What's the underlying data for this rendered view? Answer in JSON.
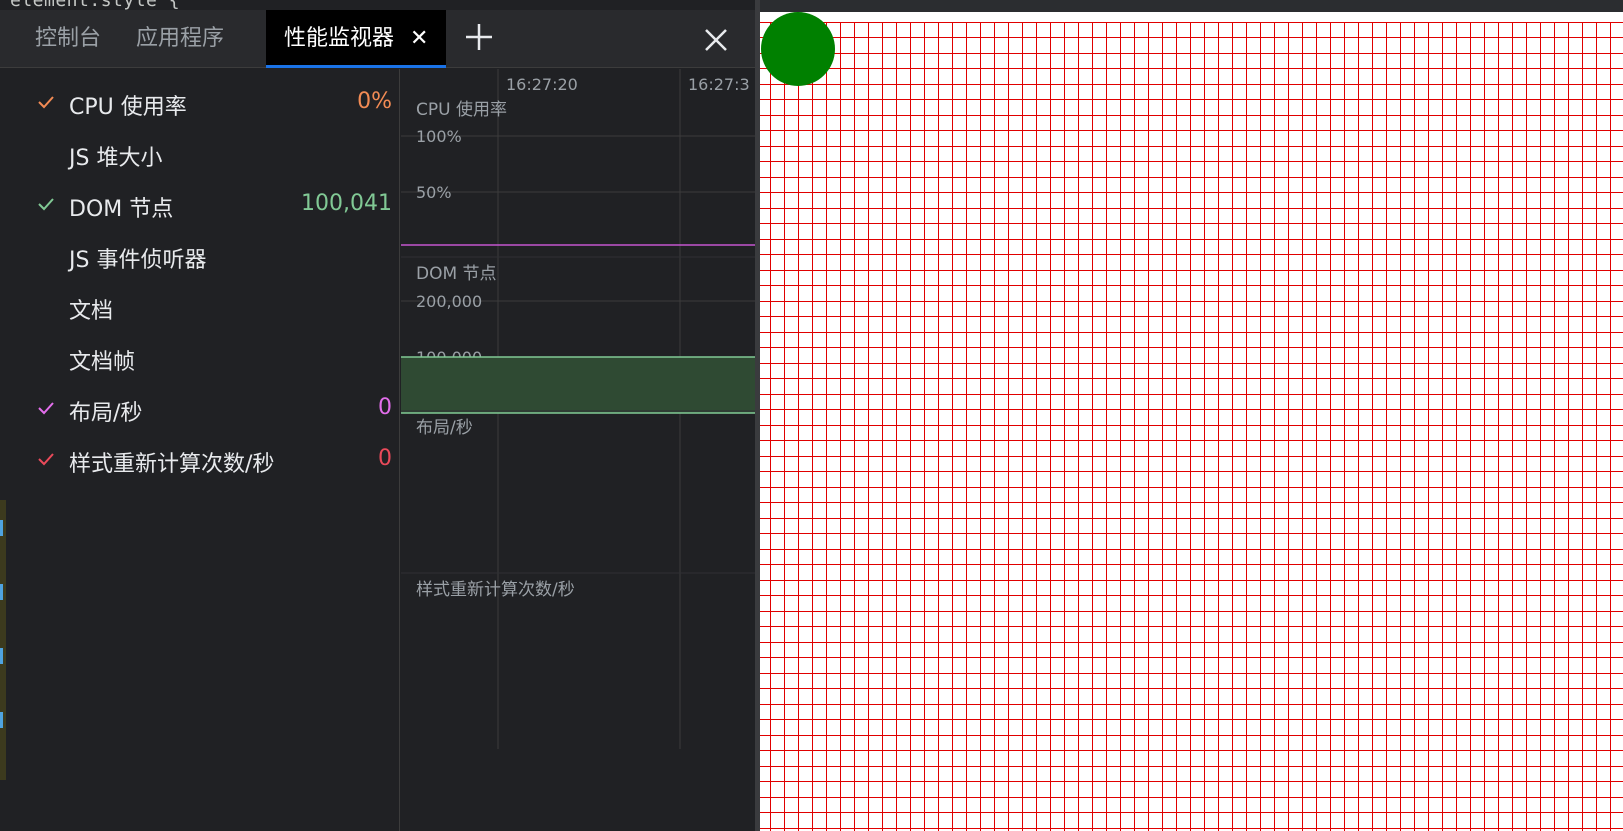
{
  "tabs": [
    {
      "label": "控制台",
      "active": false
    },
    {
      "label": "应用程序",
      "active": false
    },
    {
      "label": "性能监视器",
      "active": true
    }
  ],
  "background_code": "element.style {",
  "metrics": [
    {
      "label": "CPU 使用率",
      "checked": true,
      "value": "0%",
      "color": "#f28b54"
    },
    {
      "label": "JS 堆大小",
      "checked": false,
      "value": "",
      "color": ""
    },
    {
      "label": "DOM 节点",
      "checked": true,
      "value": "100,041",
      "color": "#81c995"
    },
    {
      "label": "JS 事件侦听器",
      "checked": false,
      "value": "",
      "color": ""
    },
    {
      "label": "文档",
      "checked": false,
      "value": "",
      "color": ""
    },
    {
      "label": "文档帧",
      "checked": false,
      "value": "",
      "color": ""
    },
    {
      "label": "布局/秒",
      "checked": true,
      "value": "0",
      "color": "#e36eec"
    },
    {
      "label": "样式重新计算次数/秒",
      "checked": true,
      "value": "0",
      "color": "#ea4a5a"
    }
  ],
  "chart_data": {
    "type": "area",
    "time_ticks": [
      "16:27:20",
      "16:27:3"
    ],
    "panels": [
      {
        "title": "CPU 使用率",
        "ticks": [
          "100%",
          "50%"
        ],
        "series": [
          {
            "color": "#c456cf",
            "values": [
              0,
              0,
              0,
              0,
              0
            ]
          }
        ]
      },
      {
        "title": "DOM 节点",
        "ticks": [
          "200,000",
          "100,000"
        ],
        "series": [
          {
            "color": "#81c995",
            "values": [
              100041,
              100041,
              100041,
              100041,
              100041
            ]
          }
        ]
      },
      {
        "title": "布局/秒",
        "ticks": [],
        "series": [
          {
            "color": "#e36eec",
            "values": [
              0,
              0,
              0,
              0,
              0
            ]
          }
        ]
      },
      {
        "title": "样式重新计算次数/秒",
        "ticks": [],
        "series": [
          {
            "color": "#ea4a5a",
            "values": [
              0,
              0,
              0,
              0,
              0
            ]
          }
        ]
      }
    ]
  },
  "colors": {
    "accent": "#1a73e8",
    "preview_grid": "#e00000",
    "preview_circle": "#008000"
  },
  "icons": {
    "add_tab": "plus-icon",
    "close_drawer": "close-icon",
    "close_tab": "close-icon",
    "check": "check-icon"
  }
}
